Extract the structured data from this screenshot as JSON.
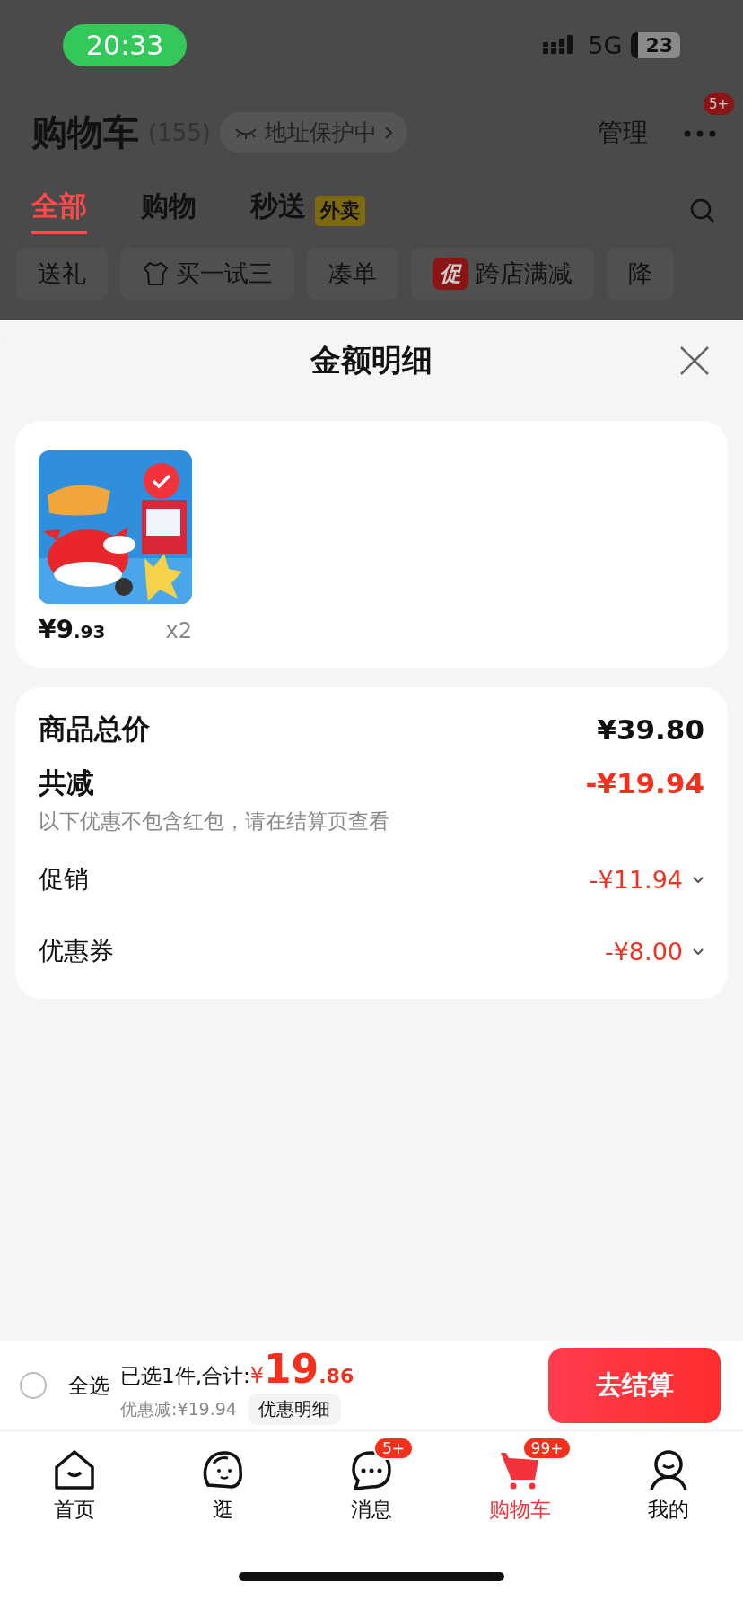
{
  "status_bar": {
    "time": "20:33",
    "network": "5G",
    "battery": "23"
  },
  "header": {
    "title": "购物车",
    "count": "(155)",
    "address_chip": "地址保护中",
    "manage": "管理",
    "more_badge": "5+"
  },
  "tabs": [
    {
      "label": "全部",
      "selected": true
    },
    {
      "label": "购物",
      "selected": false
    },
    {
      "label": "秒送",
      "selected": false,
      "tag": "外卖"
    }
  ],
  "chips": [
    {
      "label": "送礼",
      "kind": "plain"
    },
    {
      "label": "买一试三",
      "kind": "shirt"
    },
    {
      "label": "凑单",
      "kind": "plain"
    },
    {
      "label": "跨店满减",
      "kind": "promo",
      "badge": "促"
    },
    {
      "label": "降",
      "kind": "plain"
    }
  ],
  "sheet": {
    "title": "金额明细",
    "products": [
      {
        "kind": "picture",
        "selected": true,
        "price_main": "¥9",
        "price_decimal": ".93",
        "quantity": "x2"
      }
    ],
    "summary": [
      {
        "kind": "total",
        "label": "商品总价",
        "amount": "¥39.80"
      },
      {
        "kind": "discount",
        "label": "共减",
        "amount": "-¥19.94",
        "note": "以下优惠不包含红包，请在结算页查看"
      },
      {
        "kind": "item",
        "label": "促销",
        "amount": "-¥11.94",
        "expanded": false
      },
      {
        "kind": "item",
        "label": "优惠券",
        "amount": "-¥8.00",
        "expanded": false
      }
    ]
  },
  "bottom_bar": {
    "select_all": {
      "label": "全选",
      "checked": false
    },
    "selected_text": "已选1件,合计:",
    "currency": "¥",
    "total_main": "19",
    "total_decimal": ".86",
    "saving": "优惠减:¥19.94",
    "detail_button": "优惠明细",
    "checkout_button": "去结算"
  },
  "nav": [
    {
      "label": "首页",
      "selected": false
    },
    {
      "label": "逛",
      "selected": false
    },
    {
      "label": "消息",
      "selected": false,
      "badge": "5+"
    },
    {
      "label": "购物车",
      "selected": true,
      "badge": "99+"
    },
    {
      "label": "我的",
      "selected": false
    }
  ]
}
